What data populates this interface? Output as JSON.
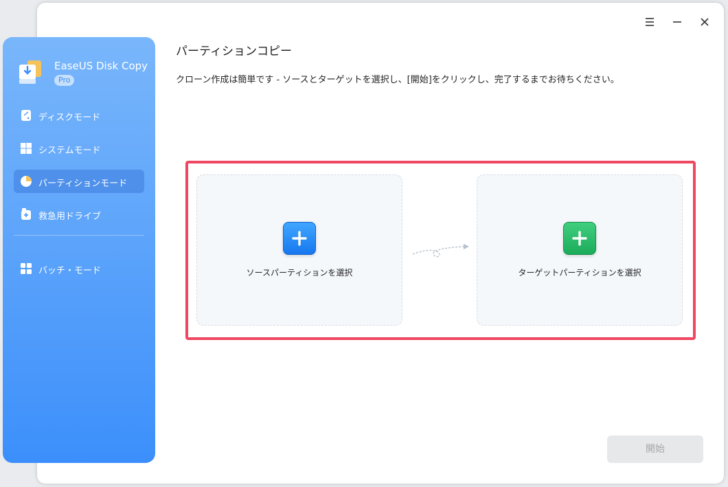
{
  "window": {
    "controls": [
      "menu-icon",
      "minimize-icon",
      "close-icon"
    ]
  },
  "sidebar": {
    "app_name": "EaseUS Disk Copy",
    "badge": "Pro",
    "items": [
      {
        "label": "ディスクモード",
        "icon": "disk-icon",
        "active": false
      },
      {
        "label": "システムモード",
        "icon": "windows-icon",
        "active": false
      },
      {
        "label": "パーティションモード",
        "icon": "pie-chart-icon",
        "active": true
      },
      {
        "label": "救急用ドライブ",
        "icon": "rescue-drive-icon",
        "active": false
      },
      {
        "label": "バッチ・モード",
        "icon": "grid-icon",
        "active": false
      }
    ]
  },
  "main": {
    "title": "パーティションコピー",
    "subtitle": "クローン作成は簡単です - ソースとターゲットを選択し、[開始]をクリックし、完了するまでお待ちください。",
    "source_card": {
      "label": "ソースパーティションを選択",
      "icon": "plus-icon"
    },
    "target_card": {
      "label": "ターゲットパーティションを選択",
      "icon": "plus-icon"
    },
    "start_button": "開始"
  },
  "colors": {
    "sidebar_top": "#79b6fb",
    "sidebar_bottom": "#3c8ffb",
    "highlight_border": "#ef4661",
    "source_button": "#1778ef",
    "target_button": "#1bab59"
  }
}
